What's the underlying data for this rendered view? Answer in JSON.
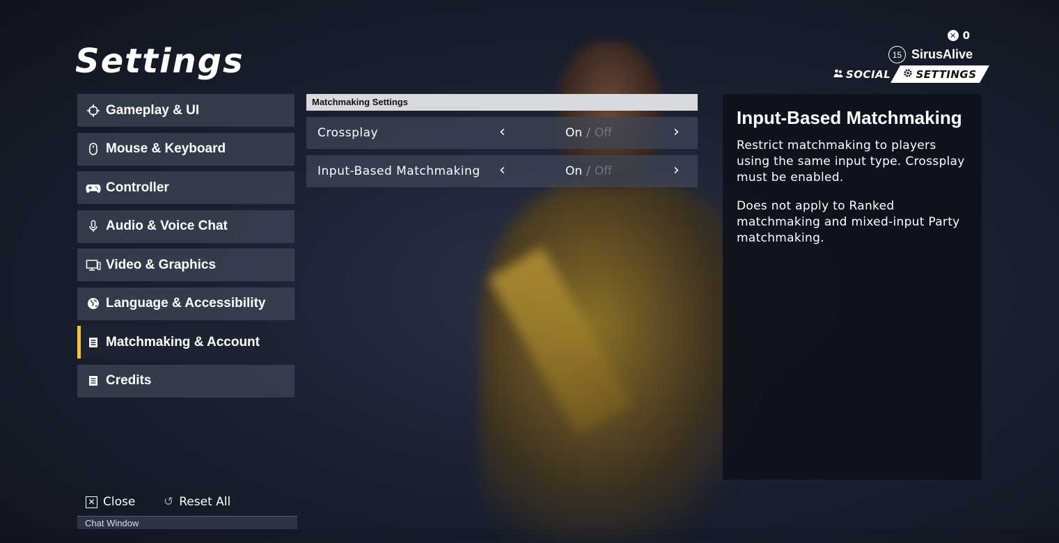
{
  "page_title": "Settings",
  "header": {
    "currency_amount": "0",
    "player_level": "15",
    "player_name": "SirusAlive",
    "tab_social": "SOCIAL",
    "tab_settings": "SETTINGS"
  },
  "sidebar": {
    "items": [
      {
        "label": "Gameplay & UI",
        "icon": "crosshair-icon"
      },
      {
        "label": "Mouse & Keyboard",
        "icon": "mouse-icon"
      },
      {
        "label": "Controller",
        "icon": "gamepad-icon"
      },
      {
        "label": "Audio & Voice Chat",
        "icon": "microphone-icon"
      },
      {
        "label": "Video & Graphics",
        "icon": "monitor-icon"
      },
      {
        "label": "Language & Accessibility",
        "icon": "globe-icon"
      },
      {
        "label": "Matchmaking & Account",
        "icon": "document-icon",
        "active": true
      },
      {
        "label": "Credits",
        "icon": "document-icon"
      }
    ]
  },
  "main": {
    "section_title": "Matchmaking Settings",
    "settings": [
      {
        "label": "Crossplay",
        "on": "On",
        "sep": "/",
        "off": "Off",
        "selected": "On"
      },
      {
        "label": "Input-Based Matchmaking",
        "on": "On",
        "sep": "/",
        "off": "Off",
        "selected": "On"
      }
    ]
  },
  "info": {
    "title": "Input-Based Matchmaking",
    "paragraph1": "Restrict matchmaking to players using the same input type. Crossplay must be enabled.",
    "paragraph2": "Does not apply to Ranked matchmaking and mixed-input Party matchmaking."
  },
  "footer": {
    "close_label": "Close",
    "reset_label": "Reset All",
    "chat_window": "Chat Window"
  },
  "colors": {
    "accent": "#f3c434",
    "panel": "#3e4658",
    "header_bar": "#d9dadd"
  }
}
